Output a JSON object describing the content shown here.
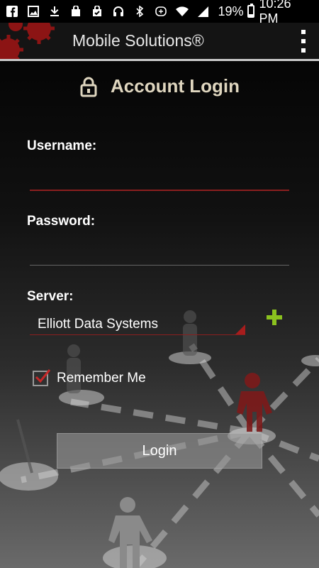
{
  "status_bar": {
    "icons": [
      "facebook-icon",
      "image-icon",
      "download-icon",
      "bag-icon",
      "bag-check-icon",
      "headphones-icon",
      "bluetooth-icon",
      "nfc-icon",
      "wifi-icon",
      "signal-icon"
    ],
    "battery": "19%",
    "battery_level": 0.19,
    "time": "10:26 PM"
  },
  "app_bar": {
    "title": "Mobile Solutions®",
    "menu_icon": "overflow-menu-icon"
  },
  "login": {
    "heading": "Account Login",
    "username_label": "Username:",
    "username_value": "",
    "password_label": "Password:",
    "password_value": "",
    "server_label": "Server:",
    "server_value": "Elliott Data Systems",
    "remember_label": "Remember Me",
    "remember_checked": true,
    "login_button": "Login"
  },
  "colors": {
    "accent_red": "#a71d1d",
    "add_green": "#8bc21f",
    "heading": "#dfd6bf"
  }
}
